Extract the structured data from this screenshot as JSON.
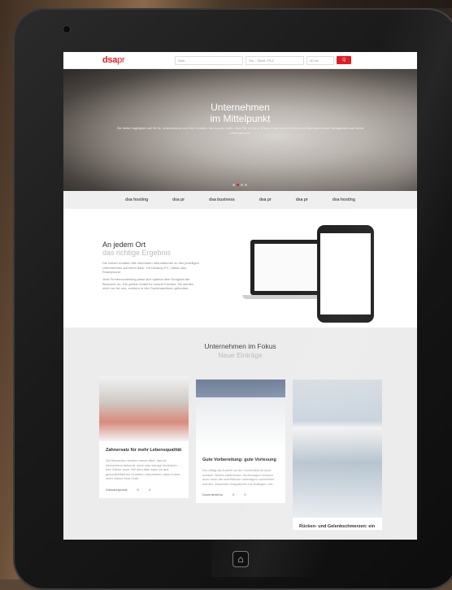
{
  "header": {
    "logo_main": "dsa",
    "logo_suffix": "pr",
    "search_what": "Was",
    "search_where": "Wo – Stadt / PLZ",
    "radius": "50 km",
    "search_btn": "Q"
  },
  "hero": {
    "title_line1": "Unternehmen",
    "title_line2": "im Mittelpunkt",
    "subtitle": "Sie bieten tagtäglich viel für Ihr Unternehmen und Ihre Kunden. Wir sorgen dafür, dass Sie mit dem Wissen mehr allein bleiben und informieren über Neuigkeiten aus Ihrem Unternehmen."
  },
  "brands": [
    "dsa hosting",
    "dsa pr",
    "dsa business",
    "dsa pr",
    "dsa pr",
    "dsa hosting"
  ],
  "anywhere": {
    "title": "An jedem Ort",
    "subtitle": "das richtige Ergebnis",
    "para1": "Die Nutzer erhalten alle relevanten Informationen zu den jeweiligen Unternehmen auf einen Blick. Ob Desktop-PC, Tablet oder Smartphone:",
    "para2": "Jede Firmenvorstellung passt sich optimal dem Endgerät der Besucher an. Der größte Vorteil für unsere Kunden: Sie werden nicht nur bei uns, sondern in den Suchmaschinen gefunden."
  },
  "focus": {
    "title": "Unternehmen im Fokus",
    "subtitle": "Neue Einträge"
  },
  "cards": [
    {
      "title": "Zahnersatz für mehr Lebensqualität",
      "text": "Die Menschen werden immer älter, das ist hinreichend bekannt, doch was wenige bedenken: Ihre Zähne auch. Mit dem Alter kann es aus gesundheitlichen Gründen vorkommen, dass immer mehr Zähne ihren Halt...",
      "author": "Zahnarztpraxis",
      "likes": "0",
      "comments": "4"
    },
    {
      "title": "Gute Vorbereitung: gute Vorlesung",
      "text": "Der Alltag als Dozent an der Universität ist nicht einfach. Neben zahlreichen Vorlesungen müssen auch noch die schriftlichen Unterlagen vorbereitet werden. Zwischen Gesprächen mit Kollegen und...",
      "author": "Dozentenbüro",
      "likes": "0",
      "comments": "0"
    },
    {
      "title": "Rücken- und Gelenkschmerzen: ein",
      "text": "",
      "author": "",
      "likes": "",
      "comments": ""
    }
  ],
  "colors": {
    "brand_red": "#e31b23"
  }
}
